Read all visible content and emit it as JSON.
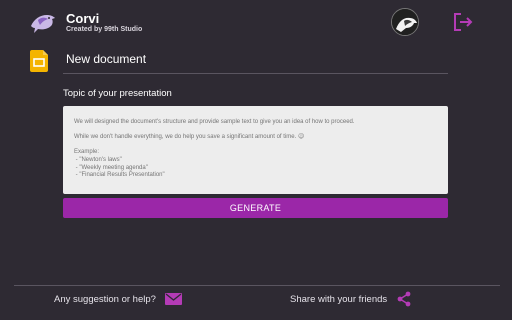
{
  "colors": {
    "background": "#2e2a33",
    "accent": "#9b27a8",
    "textbox": "#ededed",
    "placeholder_text": "#a9a9a9",
    "slides_icon": "#f4b400"
  },
  "header": {
    "app_name": "Corvi",
    "subtitle": "Created by 99th Studio",
    "logo_icon": "raven-logo-icon",
    "avatar_icon": "user-avatar-icon",
    "logout_icon": "logout-icon"
  },
  "document": {
    "icon": "google-slides-icon",
    "title": "New document"
  },
  "form": {
    "topic_label": "Topic of your presentation",
    "placeholder": "We will designed the document's structure and provide sample text to give you an idea of how to proceed.\n\nWhile we don't handle everything, we do help you save a significant amount of time. 😉\n\nExample:\n - \"Newton's laws\"\n - \"Weekly meeting agenda\"\n - \"Financial Results Presentation\"",
    "generate_label": "GENERATE"
  },
  "footer": {
    "suggestion_label": "Any suggestion or help?",
    "suggestion_icon": "mail-icon",
    "share_label": "Share with your friends",
    "share_icon": "share-icon"
  }
}
